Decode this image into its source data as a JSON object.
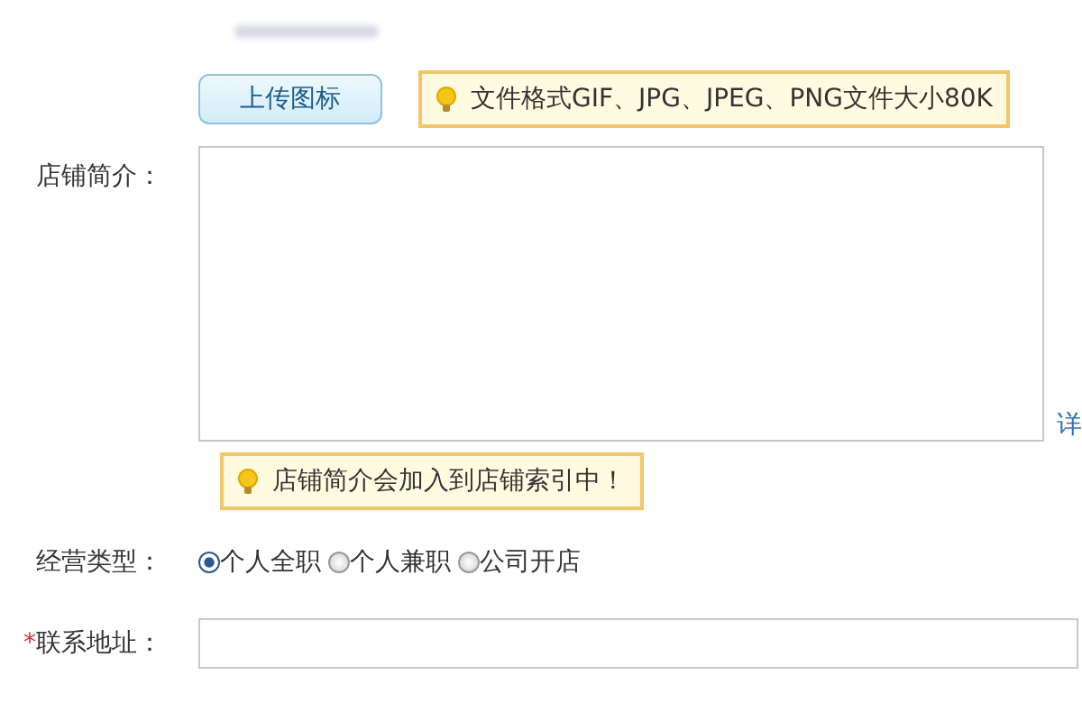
{
  "upload": {
    "button": "上传图标",
    "tip": "文件格式GIF、JPG、JPEG、PNG文件大小80K"
  },
  "intro": {
    "label": "店铺简介：",
    "link": "详",
    "tip": "店铺简介会加入到店铺索引中！"
  },
  "business_type": {
    "label": "经营类型：",
    "options": [
      {
        "label": "个人全职",
        "selected": true
      },
      {
        "label": "个人兼职",
        "selected": false
      },
      {
        "label": "公司开店",
        "selected": false
      }
    ]
  },
  "address": {
    "required_mark": "*",
    "label": "联系地址："
  }
}
